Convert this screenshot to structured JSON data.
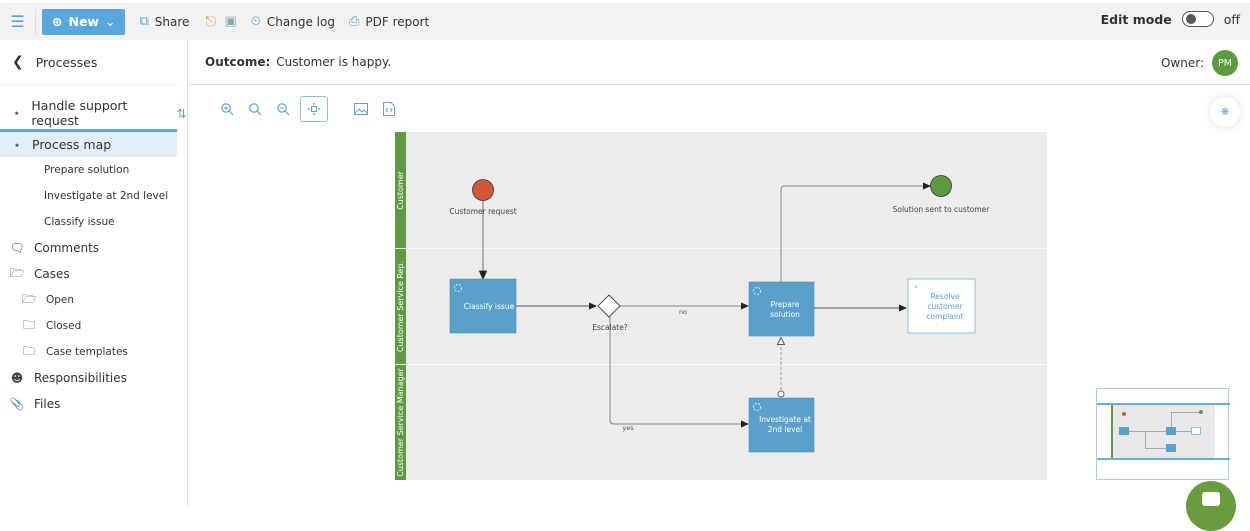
{
  "toolbar": {
    "new_label": "New",
    "share_label": "Share",
    "changelog_label": "Change log",
    "pdf_label": "PDF report",
    "edit_mode_label": "Edit mode",
    "edit_mode_state": "off",
    "icons": {
      "menu": "hamburger-icon",
      "new": "plus-circle-icon",
      "share": "share-icon",
      "lock": "lock-icon",
      "ruler": "ruler-icon",
      "changelog": "history-icon",
      "pdf": "printer-icon"
    }
  },
  "sidebar": {
    "back_label": "Processes",
    "process_name": "Handle support request",
    "active_item": "Process map",
    "sub_items": [
      "Prepare solution",
      "Investigate at 2nd level",
      "Classify issue"
    ],
    "comments": "Comments",
    "cases": "Cases",
    "case_items": [
      "Open",
      "Closed",
      "Case templates"
    ],
    "responsibilities": "Responsibilities",
    "files": "Files"
  },
  "header": {
    "outcome_key": "Outcome:",
    "outcome_value": "Customer is happy.",
    "owner_label": "Owner:",
    "owner_initials": "PM"
  },
  "diagram": {
    "lanes": [
      "Customer",
      "Customer Service Rep.",
      "Customer Service Manager"
    ],
    "start_event": "Customer request",
    "end_event": "Solution sent to customer",
    "tasks": {
      "classify": "Classify issue",
      "prepare_l1": "Prepare",
      "prepare_l2": "solution",
      "investigate_l1": "Investigate at",
      "investigate_l2": "2nd level"
    },
    "subprocess": [
      "Resolve",
      "customer",
      "complaint"
    ],
    "gateway": "Escalate?",
    "flow_no": "no",
    "flow_yes": "yes",
    "colors": {
      "lane": "#5e9a44",
      "task": "#5aa0cc",
      "start": "#d0573a",
      "end": "#5e9a44",
      "subprocess_text": "#5ba3d9"
    }
  }
}
